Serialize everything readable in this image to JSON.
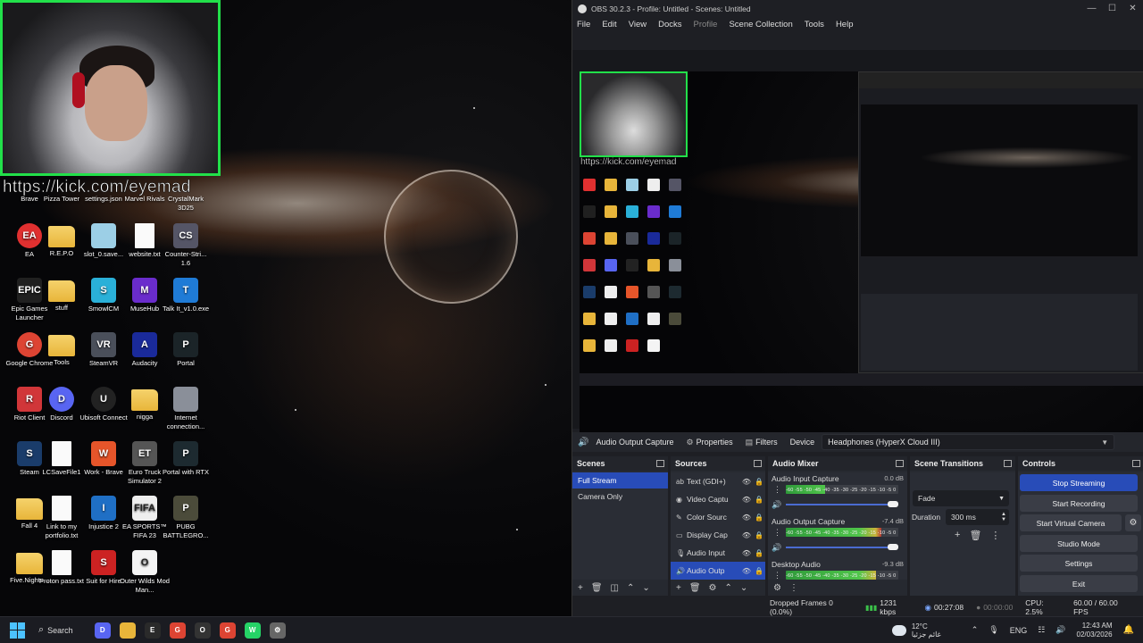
{
  "desktop": {
    "webcam_url": "https://kick.com/eyemad",
    "icons": [
      {
        "label": "Brave",
        "color": "#f05a24",
        "glyph": "B",
        "col": 0,
        "row": 0,
        "partial": true
      },
      {
        "label": "Pizza Tower",
        "color": "#c34",
        "glyph": "P",
        "col": 1,
        "row": 0,
        "partial": true
      },
      {
        "label": "settings.json",
        "color": "#3b7",
        "glyph": "{}",
        "col": 2,
        "row": 0,
        "partial": true
      },
      {
        "label": "Marvel Rivals",
        "color": "#a22",
        "glyph": "M",
        "col": 3,
        "row": 0,
        "partial": true
      },
      {
        "label": "CrystalMark 3D25",
        "color": "#2a6",
        "glyph": "C",
        "col": 4,
        "row": 0,
        "partial": true
      },
      {
        "label": "EA",
        "color": "#e03030",
        "glyph": "EA",
        "col": 0,
        "row": 1
      },
      {
        "label": "R.E.P.O",
        "color": "folder",
        "glyph": "",
        "col": 1,
        "row": 1
      },
      {
        "label": "slot_0.save...",
        "color": "#9ccfe6",
        "glyph": "",
        "col": 2,
        "row": 1
      },
      {
        "label": "website.txt",
        "color": "doc",
        "glyph": "",
        "col": 3,
        "row": 1
      },
      {
        "label": "Counter-Stri... 1.6",
        "color": "#556",
        "glyph": "CS",
        "col": 4,
        "row": 1
      },
      {
        "label": "Epic Games Launcher",
        "color": "#202020",
        "glyph": "EPIC",
        "col": 0,
        "row": 2
      },
      {
        "label": "stuff",
        "color": "folder",
        "glyph": "",
        "col": 1,
        "row": 2
      },
      {
        "label": "SmowlCM",
        "color": "#2ab0d8",
        "glyph": "S",
        "col": 2,
        "row": 2
      },
      {
        "label": "MuseHub",
        "color": "#6a2ccc",
        "glyph": "M",
        "col": 3,
        "row": 2
      },
      {
        "label": "Talk It_v1.0.exe",
        "color": "#1f7bd6",
        "glyph": "T",
        "col": 4,
        "row": 2
      },
      {
        "label": "Google Chrome",
        "color": "#dd4433",
        "glyph": "G",
        "col": 0,
        "row": 3
      },
      {
        "label": "Tools",
        "color": "folder",
        "glyph": "",
        "col": 1,
        "row": 3
      },
      {
        "label": "SteamVR",
        "color": "#4a4f5a",
        "glyph": "VR",
        "col": 2,
        "row": 3
      },
      {
        "label": "Audacity",
        "color": "#1a2a9a",
        "glyph": "A",
        "col": 3,
        "row": 3
      },
      {
        "label": "Portal",
        "color": "#1b2428",
        "glyph": "P",
        "col": 4,
        "row": 3
      },
      {
        "label": "Riot Client",
        "color": "#d13639",
        "glyph": "R",
        "col": 0,
        "row": 4
      },
      {
        "label": "Discord",
        "color": "#5865f2",
        "glyph": "D",
        "col": 1,
        "row": 4
      },
      {
        "label": "Ubisoft Connect",
        "color": "#222",
        "glyph": "U",
        "col": 2,
        "row": 4
      },
      {
        "label": "nigga",
        "color": "folder",
        "glyph": "",
        "col": 3,
        "row": 4
      },
      {
        "label": "Internet connection...",
        "color": "#8a8f99",
        "glyph": "",
        "col": 4,
        "row": 4
      },
      {
        "label": "Steam",
        "color": "#1a3c6a",
        "glyph": "S",
        "col": 0,
        "row": 5
      },
      {
        "label": "LCSaveFile1",
        "color": "doc",
        "glyph": "",
        "col": 1,
        "row": 5
      },
      {
        "label": "Work - Brave",
        "color": "#e6552a",
        "glyph": "W",
        "col": 2,
        "row": 5
      },
      {
        "label": "Euro Truck Simulator 2",
        "color": "#555",
        "glyph": "ET",
        "col": 3,
        "row": 5
      },
      {
        "label": "Portal with RTX",
        "color": "#1d2a30",
        "glyph": "P",
        "col": 4,
        "row": 5
      },
      {
        "label": "Fall 4",
        "color": "folder",
        "glyph": "",
        "col": 0,
        "row": 6
      },
      {
        "label": "Link to my portfolio.txt",
        "color": "doc",
        "glyph": "",
        "col": 1,
        "row": 6
      },
      {
        "label": "Injustice 2",
        "color": "#1f6fc5",
        "glyph": "I",
        "col": 2,
        "row": 6
      },
      {
        "label": "EA SPORTS™ FIFA 23",
        "color": "#eee",
        "glyph": "FIFA",
        "col": 3,
        "row": 6
      },
      {
        "label": "PUBG BATTLEGRO...",
        "color": "#4b4b3a",
        "glyph": "P",
        "col": 4,
        "row": 6
      },
      {
        "label": "Five.Nights...",
        "color": "folder",
        "glyph": "",
        "col": 0,
        "row": 7
      },
      {
        "label": "Proton pass.txt",
        "color": "doc",
        "glyph": "",
        "col": 1,
        "row": 7
      },
      {
        "label": "Suit for Hire",
        "color": "#c22",
        "glyph": "S",
        "col": 2,
        "row": 7
      },
      {
        "label": "Outer Wilds Mod Man...",
        "color": "#f4f4f4",
        "glyph": "O",
        "col": 3,
        "row": 7
      }
    ]
  },
  "obs": {
    "title": "OBS 30.2.3 - Profile: Untitled - Scenes: Untitled",
    "menu": [
      "File",
      "Edit",
      "View",
      "Docks",
      "Profile",
      "Scene Collection",
      "Tools",
      "Help"
    ],
    "preview_url": "https://kick.com/eyemad",
    "source_bar": {
      "selected_source": "Audio Output Capture",
      "properties": "Properties",
      "filters": "Filters",
      "device_label": "Device",
      "device_value": "Headphones (HyperX Cloud III)"
    },
    "scenes": {
      "title": "Scenes",
      "items": [
        {
          "name": "Full Stream",
          "selected": true
        },
        {
          "name": "Camera Only",
          "selected": false
        }
      ]
    },
    "sources": {
      "title": "Sources",
      "items": [
        {
          "name": "Text (GDI+)",
          "icon": "ab",
          "selected": false
        },
        {
          "name": "Video Captu",
          "icon": "cam",
          "selected": false
        },
        {
          "name": "Color Sourc",
          "icon": "brush",
          "selected": false
        },
        {
          "name": "Display Cap",
          "icon": "monitor",
          "selected": false
        },
        {
          "name": "Audio Input",
          "icon": "mic",
          "selected": false
        },
        {
          "name": "Audio Outp",
          "icon": "speaker",
          "selected": true
        }
      ]
    },
    "mixer": {
      "title": "Audio Mixer",
      "channels": [
        {
          "name": "Audio Input Capture",
          "db": "0.0 dB",
          "level": 0.35
        },
        {
          "name": "Audio Output Capture",
          "db": "-7.4 dB",
          "level": 0.85
        },
        {
          "name": "Desktop Audio",
          "db": "-9.3 dB",
          "level": 0.8
        }
      ],
      "scale": "-60 -55 -50 -45 -40 -35 -30 -25 -20 -15 -10 -5 0"
    },
    "transitions": {
      "title": "Scene Transitions",
      "type": "Fade",
      "duration_label": "Duration",
      "duration_value": "300 ms"
    },
    "controls": {
      "title": "Controls",
      "stop_streaming": "Stop Streaming",
      "start_recording": "Start Recording",
      "start_virtual_camera": "Start Virtual Camera",
      "studio_mode": "Studio Mode",
      "settings": "Settings",
      "exit": "Exit"
    },
    "status": {
      "dropped": "Dropped Frames 0 (0.0%)",
      "bitrate": "1231 kbps",
      "stream_time": "00:27:08",
      "rec_time": "00:00:00",
      "cpu": "CPU: 2.5%",
      "fps": "60.00 / 60.00 FPS"
    }
  },
  "taskbar": {
    "search": "Search",
    "apps": [
      {
        "name": "discord",
        "color": "#5865f2",
        "glyph": "D"
      },
      {
        "name": "file-explorer",
        "color": "#e8b53a",
        "glyph": ""
      },
      {
        "name": "epic-games",
        "color": "#2a2a2a",
        "glyph": "E"
      },
      {
        "name": "chrome",
        "color": "#dd4433",
        "glyph": "G"
      },
      {
        "name": "obs-taskbar",
        "color": "#333",
        "glyph": "O"
      },
      {
        "name": "chrome-2",
        "color": "#dd4433",
        "glyph": "G"
      },
      {
        "name": "whatsapp",
        "color": "#25d366",
        "glyph": "W"
      },
      {
        "name": "settings-app",
        "color": "#666",
        "glyph": "⚙"
      }
    ],
    "weather_temp": "12°C",
    "weather_text": "غائم جزئيا",
    "lang": "ENG",
    "time": "12:43 AM",
    "date": "02/03/2026"
  }
}
